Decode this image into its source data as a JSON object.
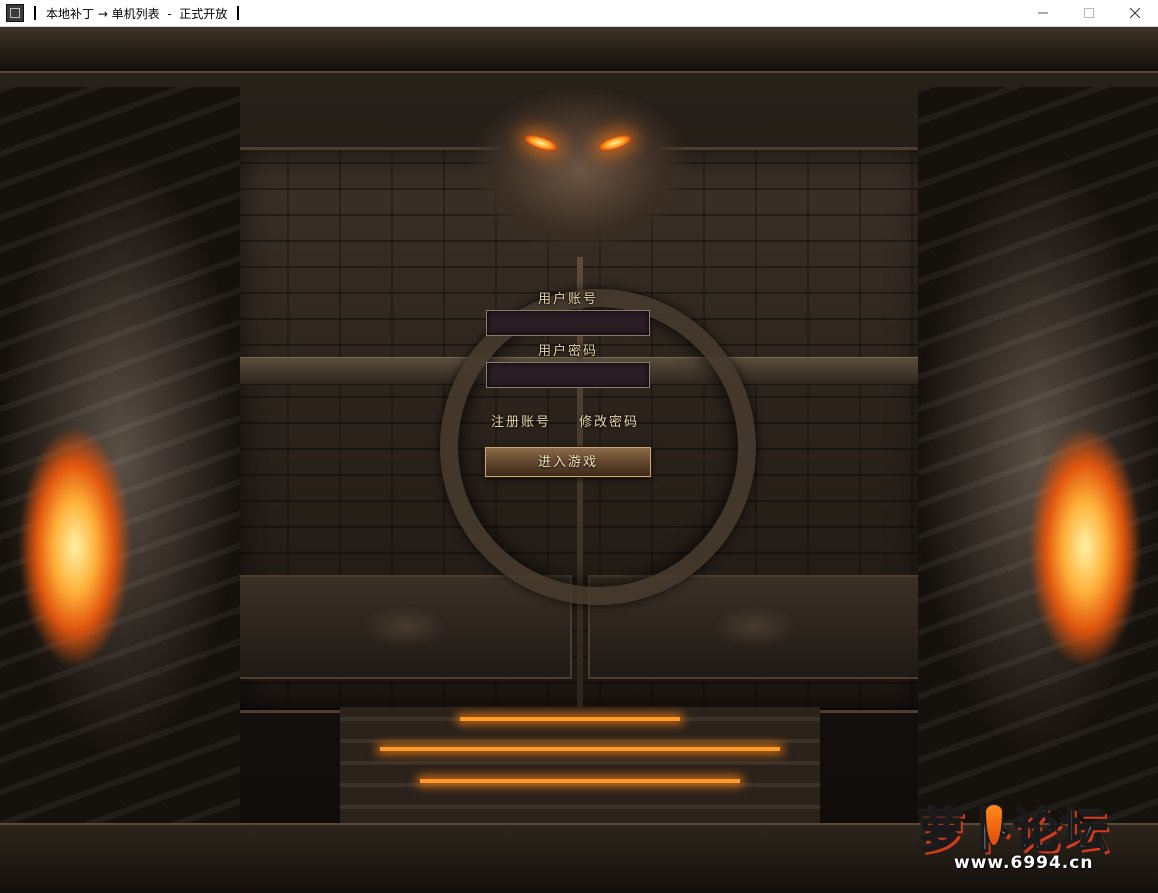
{
  "window": {
    "title": "本地补丁 → 单机列表  -  正式开放",
    "controls": {
      "minimize_icon": "minimize-icon",
      "maximize_icon": "maximize-icon",
      "close_icon": "close-icon"
    }
  },
  "login": {
    "username_label": "用户账号",
    "username_value": "",
    "password_label": "用户密码",
    "password_value": "",
    "register_link": "注册账号",
    "change_password_link": "修改密码",
    "enter_button": "进入游戏"
  },
  "watermark": {
    "logo_text": "萝卜论坛",
    "url": "www.6994.cn"
  },
  "colors": {
    "label_gold": "#e8d3a6",
    "input_bg": "#2a1e24",
    "button_bg": "#5e442c",
    "fire": "#ff9b2a"
  }
}
